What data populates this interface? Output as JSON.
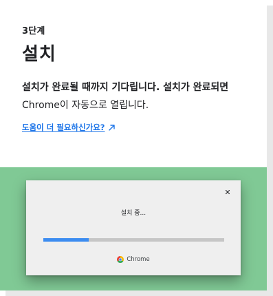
{
  "step": {
    "label": "3단계",
    "title": "설치",
    "description_bold": "설치가 완료될 때까지 기다립니다. 설치가 완료되면 ",
    "description_app": "Chrome",
    "description_tail": "이 자동으로 열립니다."
  },
  "help_link": {
    "label": "도움이 더 필요하신가요?",
    "icon": "external-arrow-icon"
  },
  "dialog": {
    "status": "설치 중...",
    "progress": 0.25,
    "brand": "Chrome",
    "close_icon": "close-icon"
  },
  "colors": {
    "accent_green": "#80c995",
    "progress_fill": "#3c8cf0",
    "link": "#1a73e8"
  }
}
